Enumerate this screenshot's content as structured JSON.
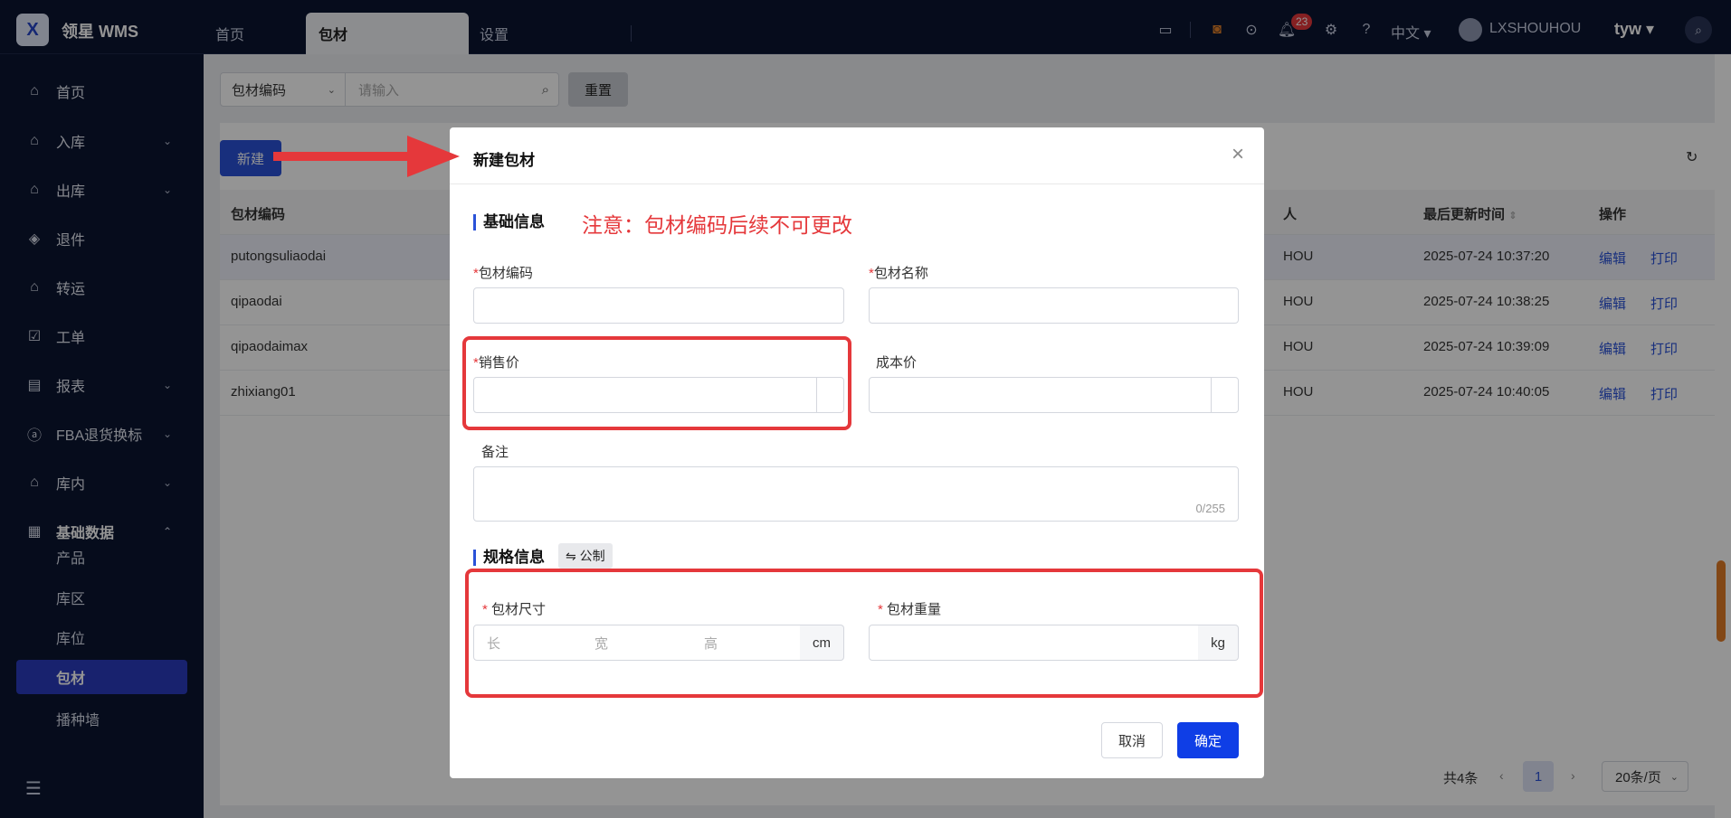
{
  "app": {
    "brand": "领星 WMS",
    "logo_letter": "X"
  },
  "top_tabs": [
    {
      "label": "首页"
    },
    {
      "label": "包材"
    },
    {
      "label": "设置"
    }
  ],
  "topbar": {
    "notification_count": "23",
    "language": "中文",
    "username": "LXSHOUHOU",
    "org": "tyw"
  },
  "sidebar": {
    "items": [
      {
        "label": "首页",
        "icon": "home-icon"
      },
      {
        "label": "入库",
        "icon": "inbound-icon"
      },
      {
        "label": "出库",
        "icon": "outbound-icon"
      },
      {
        "label": "退件",
        "icon": "return-icon"
      },
      {
        "label": "转运",
        "icon": "transfer-icon"
      },
      {
        "label": "工单",
        "icon": "workorder-icon"
      },
      {
        "label": "报表",
        "icon": "report-icon"
      },
      {
        "label": "FBA退货换标",
        "icon": "fba-icon"
      },
      {
        "label": "库内",
        "icon": "warehouse-icon"
      },
      {
        "label": "基础数据",
        "icon": "grid-icon"
      }
    ],
    "sub_items": [
      {
        "label": "产品"
      },
      {
        "label": "库区"
      },
      {
        "label": "库位"
      },
      {
        "label": "包材"
      },
      {
        "label": "播种墙"
      }
    ]
  },
  "filter": {
    "field_select": "包材编码",
    "search_placeholder": "请输入",
    "reset_label": "重置"
  },
  "list": {
    "new_label": "新建",
    "columns": [
      "包材编码",
      "人",
      "最后更新时间",
      "操作"
    ],
    "rows": [
      {
        "code": "putongsuliaodai",
        "user": "HOU",
        "time": "2025-07-24 10:37:20"
      },
      {
        "code": "qipaodai",
        "user": "HOU",
        "time": "2025-07-24 10:38:25"
      },
      {
        "code": "qipaodaimax",
        "user": "HOU",
        "time": "2025-07-24 10:39:09"
      },
      {
        "code": "zhixiang01",
        "user": "HOU",
        "time": "2025-07-24 10:40:05"
      }
    ],
    "edit_label": "编辑",
    "print_label": "打印",
    "pager": {
      "total": "共4条",
      "page": "1",
      "size": "20条/页"
    }
  },
  "modal": {
    "title": "新建包材",
    "basic_section": "基础信息",
    "note": "注意：包材编码后续不可更改",
    "fields": {
      "code": "包材编码",
      "name": "包材名称",
      "sale_price": "销售价",
      "cost_price": "成本价",
      "remark": "备注",
      "remark_count": "0/255"
    },
    "spec_section": "规格信息",
    "unit_toggle": "⇋ 公制",
    "size_label": "包材尺寸",
    "size_placeholders": {
      "l": "长",
      "w": "宽",
      "h": "高"
    },
    "size_unit": "cm",
    "weight_label": "包材重量",
    "weight_unit": "kg",
    "cancel_label": "取消",
    "confirm_label": "确定"
  },
  "colors": {
    "accent": "#2a52d8",
    "annotation": "#e5383b",
    "topbar": "#0b1531"
  }
}
